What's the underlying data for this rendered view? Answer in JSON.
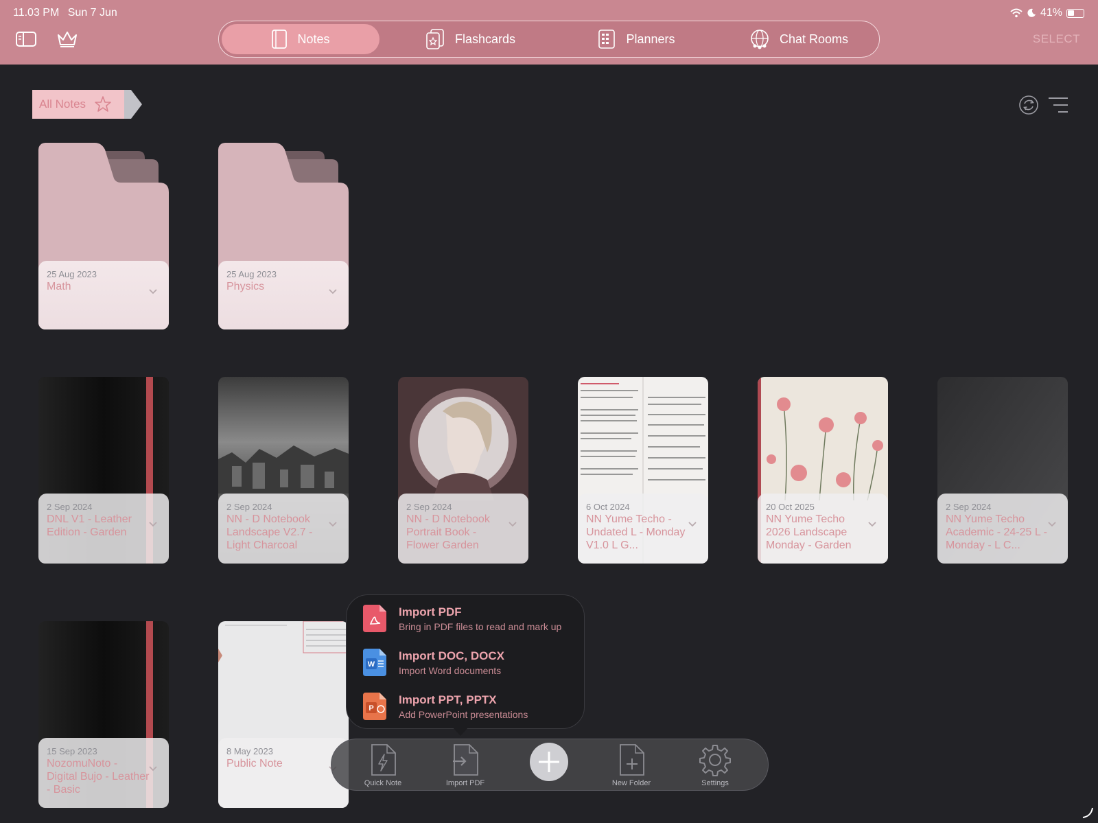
{
  "status": {
    "time": "11.03 PM",
    "date": "Sun 7 Jun",
    "battery": "41%"
  },
  "tabs": [
    {
      "label": "Notes",
      "icon": "notebook-icon",
      "active": true
    },
    {
      "label": "Flashcards",
      "icon": "flashcards-icon",
      "active": false
    },
    {
      "label": "Planners",
      "icon": "planner-icon",
      "active": false
    },
    {
      "label": "Chat Rooms",
      "icon": "globe-people-icon",
      "active": false
    }
  ],
  "toolbar": {
    "select_label": "SELECT"
  },
  "breadcrumb": {
    "label": "All Notes"
  },
  "folders": [
    {
      "date": "25 Aug 2023",
      "title": "Math"
    },
    {
      "date": "25 Aug 2023",
      "title": "Physics"
    }
  ],
  "notebooks": [
    {
      "date": "2 Sep 2024",
      "title": "DNL V1 - Leather Edition - Garden",
      "cover": "black-leather"
    },
    {
      "date": "2 Sep 2024",
      "title": "NN - D Notebook Landscape V2.7 - Light Charcoal",
      "cover": "charcoal-landscape"
    },
    {
      "date": "2 Sep 2024",
      "title": "NN - D Notebook Portrait Book - Flower Garden",
      "cover": "portrait-woman"
    },
    {
      "date": "6 Oct 2024",
      "title": "NN Yume Techo - Undated L - Monday V1.0 L G...",
      "cover": "text-page"
    },
    {
      "date": "20 Oct 2025",
      "title": "NN Yume Techo 2026 Landscape Monday - Garden",
      "cover": "pink-flowers"
    },
    {
      "date": "2 Sep 2024",
      "title": "NN Yume Techo Academic - 24-25 L - Monday - L C...",
      "cover": "dark-plain"
    },
    {
      "date": "15 Sep 2023",
      "title": "NozomuNoto - Digital Bujo - Leather - Basic",
      "cover": "black-leather"
    },
    {
      "date": "8 May 2023",
      "title": "Public Note",
      "cover": "white-page"
    }
  ],
  "import_menu": [
    {
      "title": "Import PDF",
      "subtitle": "Bring in PDF files to read and mark up",
      "icon": "pdf-file-icon",
      "color": "#e8596a"
    },
    {
      "title": "Import DOC, DOCX",
      "subtitle": "Import Word documents",
      "icon": "word-file-icon",
      "color": "#4a90e2"
    },
    {
      "title": "Import PPT, PPTX",
      "subtitle": "Add PowerPoint presentations",
      "icon": "powerpoint-file-icon",
      "color": "#e8744a"
    }
  ],
  "dock": [
    {
      "label": "Quick Note",
      "icon": "lightning-file-icon"
    },
    {
      "label": "Import PDF",
      "icon": "import-file-icon"
    },
    {
      "label": "New Folder",
      "icon": "new-folder-icon"
    },
    {
      "label": "Settings",
      "icon": "gear-icon"
    }
  ]
}
